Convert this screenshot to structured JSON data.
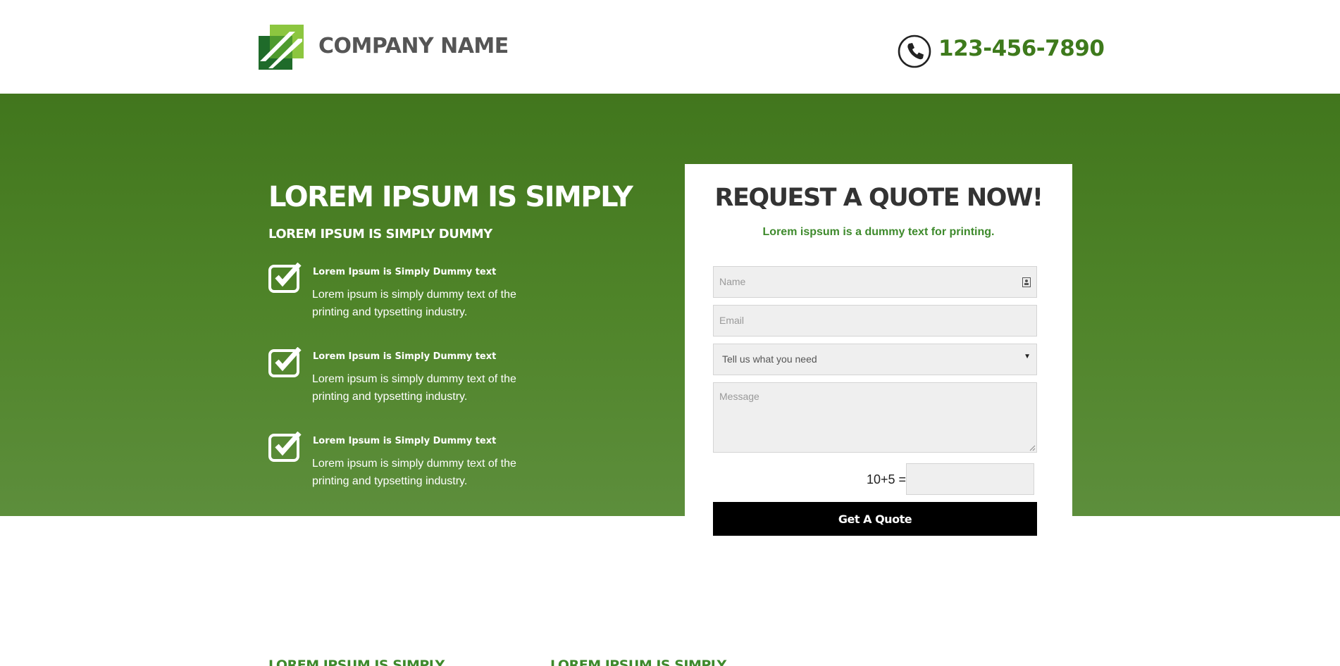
{
  "header": {
    "company_name": "COMPANY NAME",
    "phone_number": "123-456-7890",
    "logo_icon": "company-logo",
    "phone_icon": "phone-icon"
  },
  "hero": {
    "title": "LOREM IPSUM IS SIMPLY",
    "subtitle": "LOREM IPSUM IS SIMPLY DUMMY",
    "features": [
      {
        "title": "Lorem Ipsum is Simply Dummy text",
        "text": "Lorem ipsum is simply dummy text of the printing and typsetting industry."
      },
      {
        "title": "Lorem Ipsum is Simply Dummy text",
        "text": "Lorem ipsum is simply dummy text of the printing and typsetting industry."
      },
      {
        "title": "Lorem Ipsum is Simply Dummy text",
        "text": "Lorem ipsum is simply dummy text of the printing and typsetting industry."
      }
    ]
  },
  "quote_form": {
    "title": "REQUEST A QUOTE NOW!",
    "subtitle": "Lorem ispsum is a dummy text for printing.",
    "name_placeholder": "Name",
    "email_placeholder": "Email",
    "select_value": "Tell us what you need",
    "message_placeholder": "Message",
    "captcha_label": "10+5 =",
    "submit_label": "Get A Quote"
  },
  "bottom": {
    "heading_1": "LOREM IPSUM IS SIMPLY",
    "heading_2": "LOREM IPSUM IS SIMPLY"
  },
  "colors": {
    "brand_green": "#3e7a1c",
    "hero_green_top": "#41761d",
    "hero_green_bottom": "#5d8e3c",
    "button_black": "#000000"
  }
}
